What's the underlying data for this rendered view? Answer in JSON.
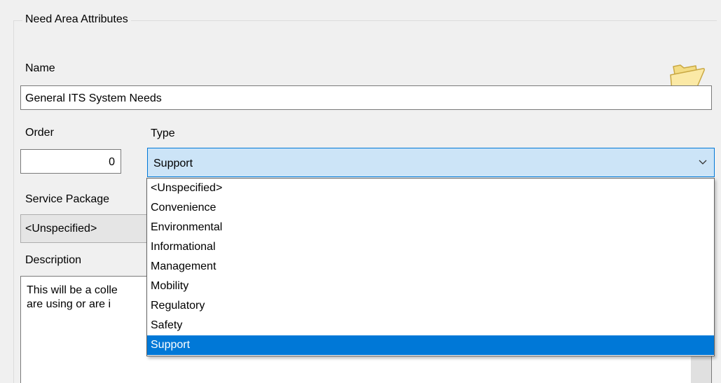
{
  "group": {
    "title": "Need Area Attributes"
  },
  "icons": {
    "folder": "folder-icon",
    "chevron": "chevron-down-icon"
  },
  "name": {
    "label": "Name",
    "value": "General ITS System Needs"
  },
  "order": {
    "label": "Order",
    "value": "0"
  },
  "type": {
    "label": "Type",
    "value": "Support",
    "options": [
      "<Unspecified>",
      "Convenience",
      "Environmental",
      "Informational",
      "Management",
      "Mobility",
      "Regulatory",
      "Safety",
      "Support"
    ],
    "selected_index": 8
  },
  "service_package": {
    "label": "Service Package",
    "value": "<Unspecified>"
  },
  "description": {
    "label": "Description",
    "lines": [
      "This will be a colle",
      "are using or are i"
    ]
  },
  "colors": {
    "selection": "#0078d7",
    "combo_focus_bg": "#cce4f7",
    "window_bg": "#f0f0f0"
  }
}
